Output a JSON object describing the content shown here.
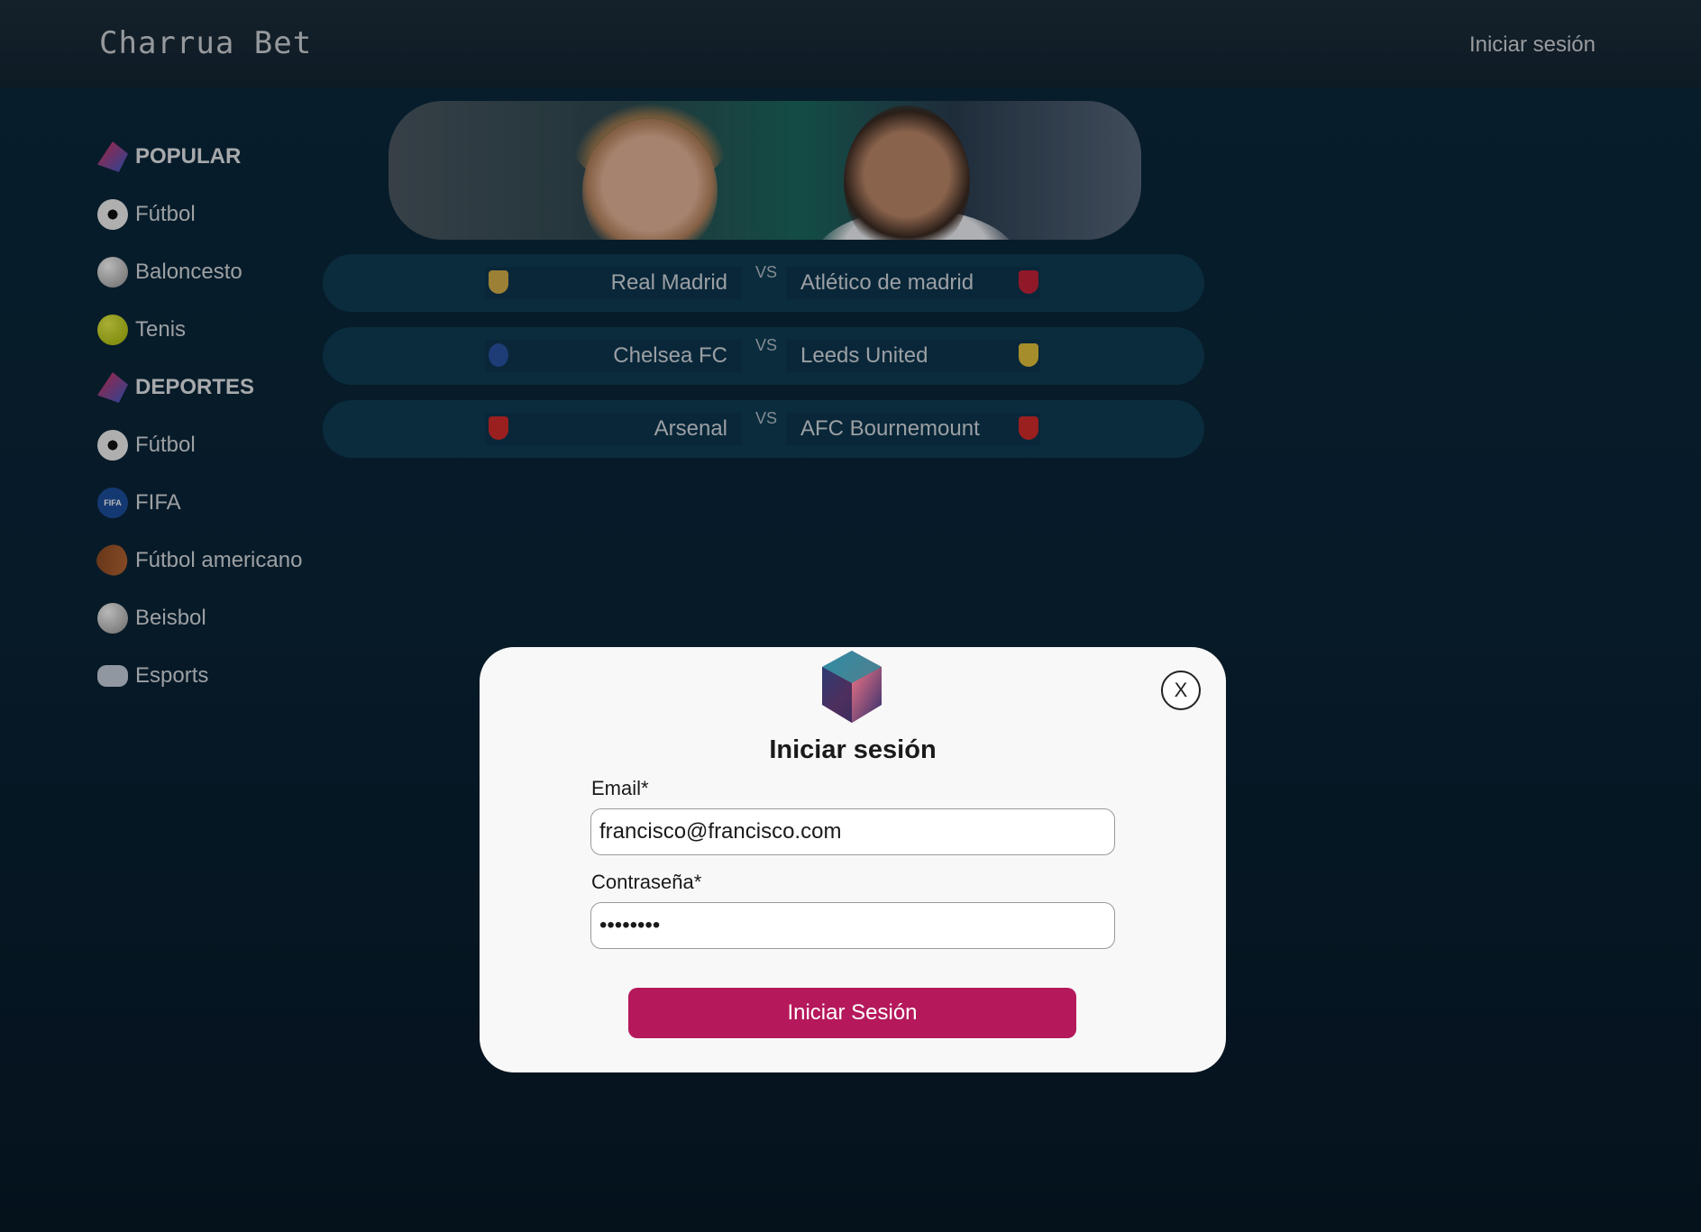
{
  "header": {
    "brand": "Charrua Bet",
    "login_link": "Iniciar sesión"
  },
  "sidebar": {
    "items": [
      {
        "label": "POPULAR",
        "icon": "popular-icon",
        "header": true
      },
      {
        "label": "Fútbol",
        "icon": "soccer-ball-icon"
      },
      {
        "label": "Baloncesto",
        "icon": "basketball-icon"
      },
      {
        "label": "Tenis",
        "icon": "tennis-ball-icon"
      },
      {
        "label": "DEPORTES",
        "icon": "sports-icon",
        "header": true
      },
      {
        "label": "Fútbol",
        "icon": "soccer-ball-icon"
      },
      {
        "label": "FIFA",
        "icon": "fifa-icon"
      },
      {
        "label": "Fútbol americano",
        "icon": "american-football-icon"
      },
      {
        "label": "Beisbol",
        "icon": "baseball-icon"
      },
      {
        "label": "Esports",
        "icon": "gamepad-icon"
      }
    ]
  },
  "matches": [
    {
      "home": "Real Madrid",
      "vs": "VS",
      "away": "Atlético de madrid",
      "home_color": "#d9b24a",
      "away_color": "#c8233a"
    },
    {
      "home": "Chelsea FC",
      "vs": "VS",
      "away": "Leeds United",
      "home_color": "#2a55a6",
      "away_color": "#e6c43c"
    },
    {
      "home": "Arsenal",
      "vs": "VS",
      "away": "AFC Bournemount",
      "home_color": "#d62b2b",
      "away_color": "#d62b2b"
    }
  ],
  "login_modal": {
    "title": "Iniciar sesión",
    "email_label": "Email*",
    "email_value": "francisco@francisco.com",
    "password_label": "Contraseña*",
    "password_value": "••••••••",
    "submit_label": "Iniciar Sesión",
    "close_label": "X"
  },
  "colors": {
    "accent": "#b5195b",
    "background": "#0a2438"
  }
}
